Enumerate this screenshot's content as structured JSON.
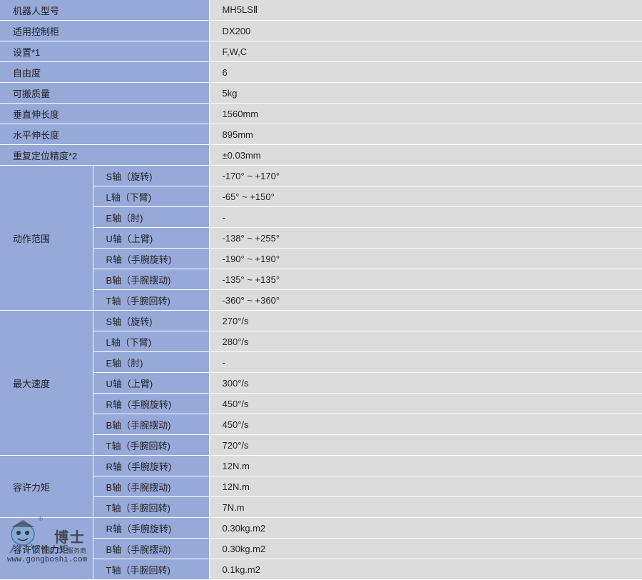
{
  "simple_rows": [
    {
      "label": "机器人型号",
      "value": "MH5LSⅡ"
    },
    {
      "label": "适用控制柜",
      "value": "DX200"
    },
    {
      "label": "设置*1",
      "value": "F,W,C"
    },
    {
      "label": "自由度",
      "value": "6"
    },
    {
      "label": "可搬质量",
      "value": "5kg"
    },
    {
      "label": "垂直伸长度",
      "value": "1560mm"
    },
    {
      "label": "水平伸长度",
      "value": "895mm"
    },
    {
      "label": "重复定位精度*2",
      "value": "±0.03mm"
    }
  ],
  "groups": [
    {
      "label": "动作范围",
      "rows": [
        {
          "axis": "S轴（旋转)",
          "value": "-170° ~ +170°"
        },
        {
          "axis": "L轴（下臂)",
          "value": "-65° ~ +150°"
        },
        {
          "axis": "E轴（肘)",
          "value": "-"
        },
        {
          "axis": "U轴（上臂)",
          "value": "-138° ~ +255°"
        },
        {
          "axis": "R轴（手腕旋转)",
          "value": "-190° ~ +190°"
        },
        {
          "axis": "B轴（手腕摆动)",
          "value": "-135° ~ +135°"
        },
        {
          "axis": "T轴（手腕回转)",
          "value": "-360° ~ +360°"
        }
      ]
    },
    {
      "label": "最大速度",
      "rows": [
        {
          "axis": "S轴（旋转)",
          "value": "270°/s"
        },
        {
          "axis": "L轴（下臂)",
          "value": "280°/s"
        },
        {
          "axis": "E轴（肘)",
          "value": "-"
        },
        {
          "axis": "U轴（上臂)",
          "value": "300°/s"
        },
        {
          "axis": "R轴（手腕旋转)",
          "value": "450°/s"
        },
        {
          "axis": "B轴（手腕摆动)",
          "value": "450°/s"
        },
        {
          "axis": "T轴（手腕回转)",
          "value": "720°/s"
        }
      ]
    },
    {
      "label": "容许力矩",
      "rows": [
        {
          "axis": "R轴（手腕旋转)",
          "value": "12N.m"
        },
        {
          "axis": "B轴（手腕摆动)",
          "value": "12N.m"
        },
        {
          "axis": "T轴（手腕回转)",
          "value": "7N.m"
        }
      ]
    },
    {
      "label": "容许惯性力矩",
      "rows": [
        {
          "axis": "R轴（手腕旋转)",
          "value": "0.30kg.m2"
        },
        {
          "axis": "B轴（手腕摆动)",
          "value": "0.30kg.m2"
        },
        {
          "axis": "T轴（手腕回转)",
          "value": "0.1kg.m2"
        }
      ]
    }
  ],
  "watermark": {
    "name": "博士",
    "tagline": "智能工厂服务商",
    "url": "www.gongboshi.com",
    "reg": "®"
  }
}
